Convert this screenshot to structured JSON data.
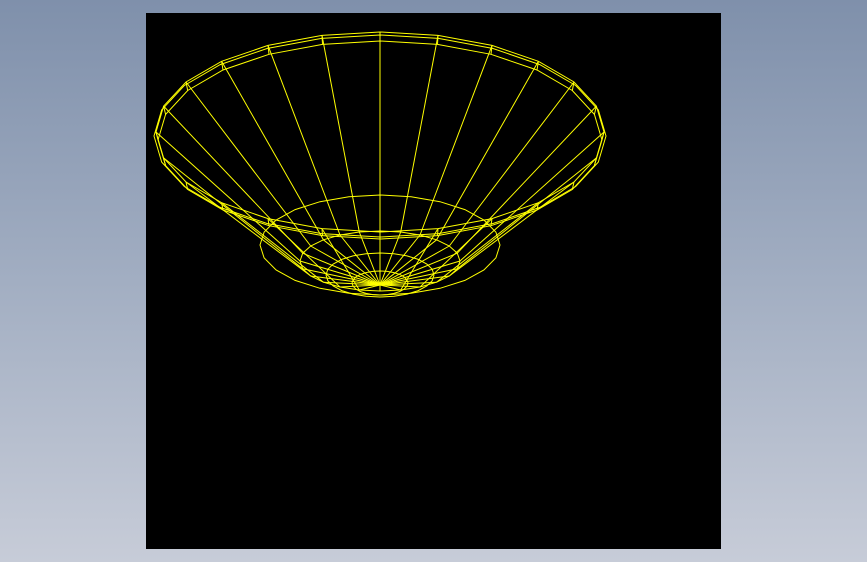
{
  "window": {
    "background_colors": [
      "#7f90ab",
      "#c7ccd8"
    ]
  },
  "viewport": {
    "background_color": "#000000",
    "wire_color": "#ffff00",
    "model": {
      "type": "wireframe-bowl",
      "radial_segments": 24,
      "outer_rim": "double-edged",
      "base_rings": 3
    }
  }
}
